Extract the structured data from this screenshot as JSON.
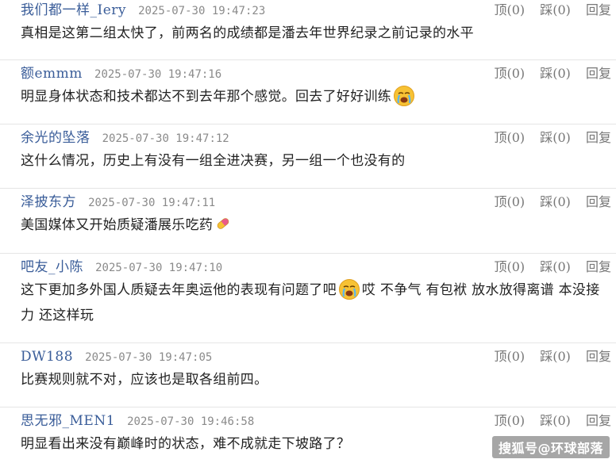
{
  "actions": {
    "agree": "顶(0)",
    "disagree": "踩(0)",
    "reply": "回复"
  },
  "comments": [
    {
      "username": "我们都一样_Iery",
      "time": "2025-07-30 19:47:23",
      "text": "真相是这第二组太快了，前两名的成绩都是潘去年世界纪录之前记录的水平"
    },
    {
      "username": "额emmm",
      "time": "2025-07-30 19:47:16",
      "text": "明显身体状态和技术都达不到去年那个感觉。回去了好好训练",
      "emoji": "crying-face-icon"
    },
    {
      "username": "余光的坠落",
      "time": "2025-07-30 19:47:12",
      "text": "这什么情况，历史上有没有一组全进决赛，另一组一个也没有的"
    },
    {
      "username": "泽披东方",
      "time": "2025-07-30 19:47:11",
      "text": "美国媒体又开始质疑潘展乐吃药",
      "emoji": "pill-icon"
    },
    {
      "username": "吧友_小陈",
      "time": "2025-07-30 19:47:10",
      "text": "这下更加多外国人质疑去年奥运他的表现有问题了吧",
      "emoji": "crying-face-icon",
      "text_after": "哎 不争气 有包袱 放水放得离谱 本没接力 还这样玩"
    },
    {
      "username": "DW188",
      "time": "2025-07-30 19:47:05",
      "text": "比赛规则就不对，应该也是取各组前四。"
    },
    {
      "username": "思无邪_MEN1",
      "time": "2025-07-30 19:46:58",
      "text": "明显看出来没有巅峰时的状态，难不成就走下坡路了？"
    }
  ],
  "watermark": "搜狐号@环球部落"
}
